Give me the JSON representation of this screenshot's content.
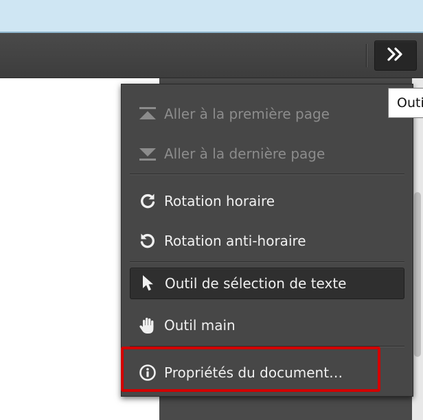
{
  "toolbar": {
    "tools_button_glyph": "»",
    "tools_button_icon": "double-chevron-right-icon"
  },
  "tooltip": {
    "text": "Outils"
  },
  "menu": {
    "items": [
      {
        "label": "Aller à la première page",
        "icon": "first-page-icon",
        "enabled": false
      },
      {
        "label": "Aller à la dernière page",
        "icon": "last-page-icon",
        "enabled": false
      },
      {
        "label": "Rotation horaire",
        "icon": "rotate-clockwise-icon",
        "enabled": true
      },
      {
        "label": "Rotation anti-horaire",
        "icon": "rotate-counterclockwise-icon",
        "enabled": true
      },
      {
        "label": "Outil de sélection de texte",
        "icon": "cursor-arrow-icon",
        "enabled": true,
        "selected": true
      },
      {
        "label": "Outil main",
        "icon": "hand-icon",
        "enabled": true
      },
      {
        "label": "Propriétés du document…",
        "icon": "info-icon",
        "enabled": true
      }
    ]
  },
  "colors": {
    "menu_background": "#474747",
    "toolbar_background": "#3d3d3d",
    "highlight_border": "#d30000",
    "window_frame": "#cfe6f3"
  }
}
